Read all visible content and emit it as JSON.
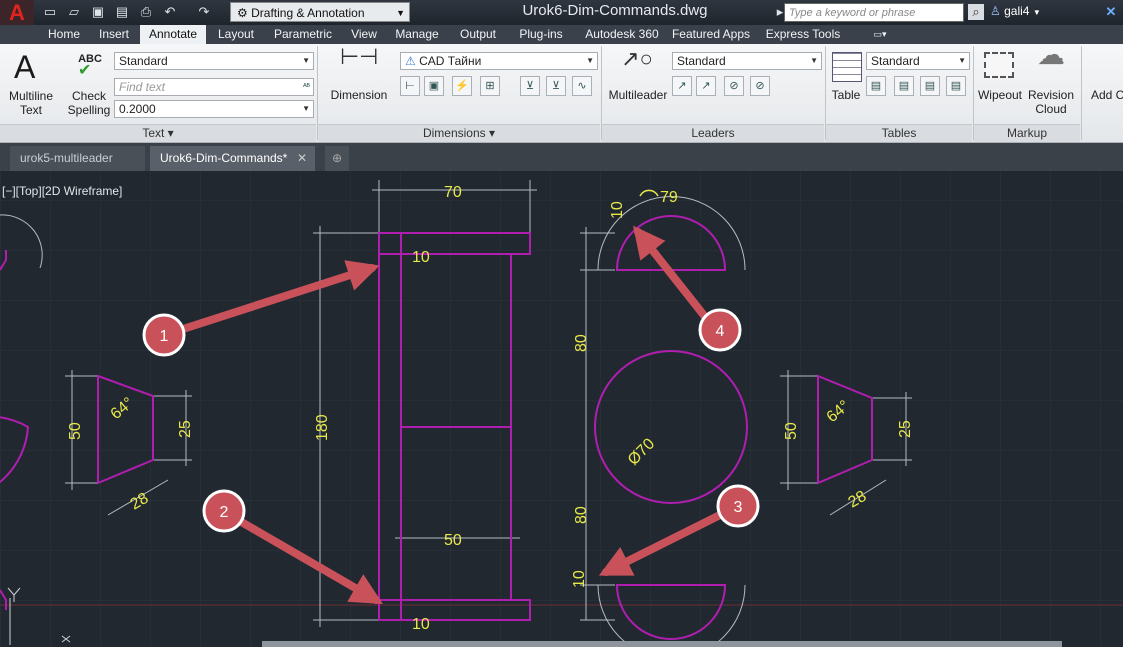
{
  "titlebar": {
    "workspace": "Drafting & Annotation",
    "document_title": "Urok6-Dim-Commands.dwg",
    "search_placeholder": "Type a keyword or phrase",
    "user": "gali4"
  },
  "ribbon_tabs": [
    {
      "label": "Home"
    },
    {
      "label": "Insert"
    },
    {
      "label": "Annotate",
      "active": true
    },
    {
      "label": "Layout"
    },
    {
      "label": "Parametric"
    },
    {
      "label": "View"
    },
    {
      "label": "Manage"
    },
    {
      "label": "Output"
    },
    {
      "label": "Plug-ins"
    },
    {
      "label": "Autodesk 360"
    },
    {
      "label": "Featured Apps"
    },
    {
      "label": "Express Tools"
    }
  ],
  "ribbon": {
    "text_panel": {
      "title": "Text",
      "multiline_line1": "Multiline",
      "multiline_line2": "Text",
      "check_line1": "Check",
      "check_line2": "Spelling",
      "abc": "ABC",
      "style_value": "Standard",
      "find_placeholder": "Find text",
      "height_value": "0.2000"
    },
    "dimensions_panel": {
      "title": "Dimensions",
      "dimension_label": "Dimension",
      "style_value": "CAD Тайни"
    },
    "leaders_panel": {
      "title": "Leaders",
      "multileader_label": "Multileader",
      "style_value": "Standard"
    },
    "tables_panel": {
      "title": "Tables",
      "table_label": "Table",
      "style_value": "Standard"
    },
    "markup_panel": {
      "title": "Markup",
      "wipeout_label": "Wipeout",
      "revision_line1": "Revision",
      "revision_line2": "Cloud"
    },
    "extra_label": "Add C"
  },
  "file_tabs": [
    {
      "label": "urok5-multileader"
    },
    {
      "label": "Urok6-Dim-Commands*",
      "active": true
    }
  ],
  "viewport_label": "[−][Top][2D Wireframe]",
  "drawing": {
    "dims": {
      "top_width": "70",
      "wall_top": "10",
      "wall_bottom": "10",
      "inner_width": "50",
      "height": "180",
      "left_angle": "64°",
      "left_height": "50",
      "left_small": "25",
      "left_slant": "28",
      "right_angle": "64°",
      "right_height": "50",
      "right_small": "25",
      "right_slant": "28",
      "arc_len": "79",
      "arc_ten_top": "10",
      "arc_ten_bottom": "10",
      "upper_80": "80",
      "lower_80": "80",
      "diameter": "Ø70"
    },
    "callouts": [
      "1",
      "2",
      "3",
      "4"
    ],
    "colors": {
      "outline": "#b01eb0",
      "dimension": "#e8e84a",
      "extension": "#b7bcc2",
      "arrow": "#c9525a",
      "background": "#212830"
    }
  }
}
